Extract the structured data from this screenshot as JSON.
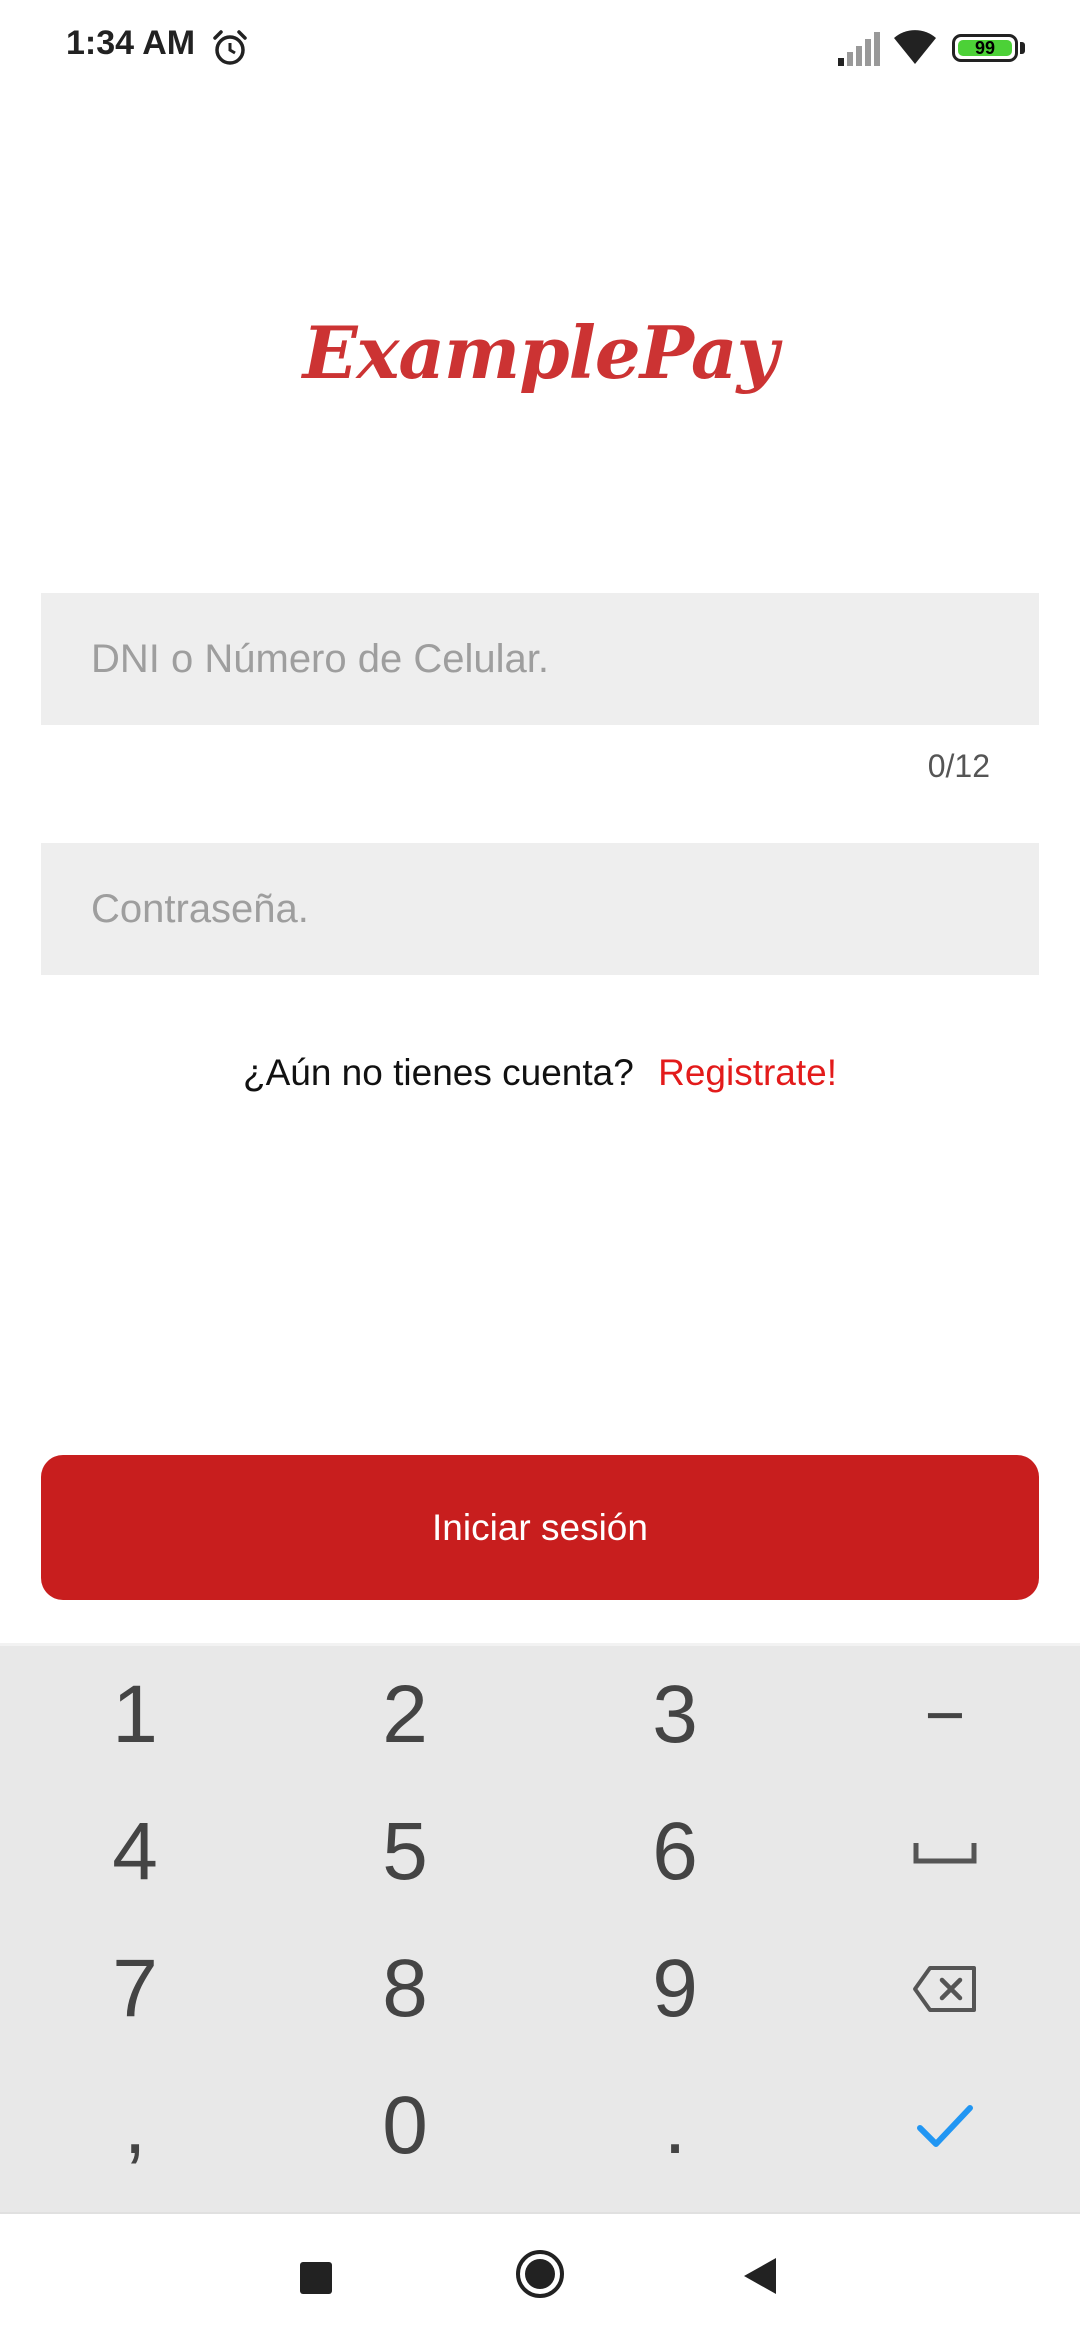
{
  "status_bar": {
    "time": "1:34 AM",
    "battery_level": "99",
    "battery_color": "#4cd137",
    "icons": [
      "alarm-icon",
      "signal-icon",
      "wifi-icon",
      "battery-icon"
    ]
  },
  "logo": {
    "text": "ExamplePay",
    "color": "#cc3333"
  },
  "login_form": {
    "dni_field": {
      "placeholder": "DNI o Número de Celular.",
      "value": "",
      "counter": "0/12"
    },
    "password_field": {
      "placeholder": "Contraseña.",
      "value": ""
    },
    "register_prompt": "¿Aún no tienes cuenta?",
    "register_link": "Registrate!",
    "login_button": "Iniciar sesión",
    "accent_color": "#c81e1e"
  },
  "keyboard": {
    "keys": [
      "1",
      "2",
      "3",
      "−",
      "4",
      "5",
      "6",
      "",
      "7",
      "8",
      "9",
      "",
      ",",
      "0",
      ".",
      ""
    ],
    "special_icons": [
      "space-icon",
      "backspace-icon",
      "done-check-icon"
    ]
  },
  "nav_bar": {
    "icons": [
      "recents-icon",
      "home-icon",
      "back-icon"
    ]
  }
}
